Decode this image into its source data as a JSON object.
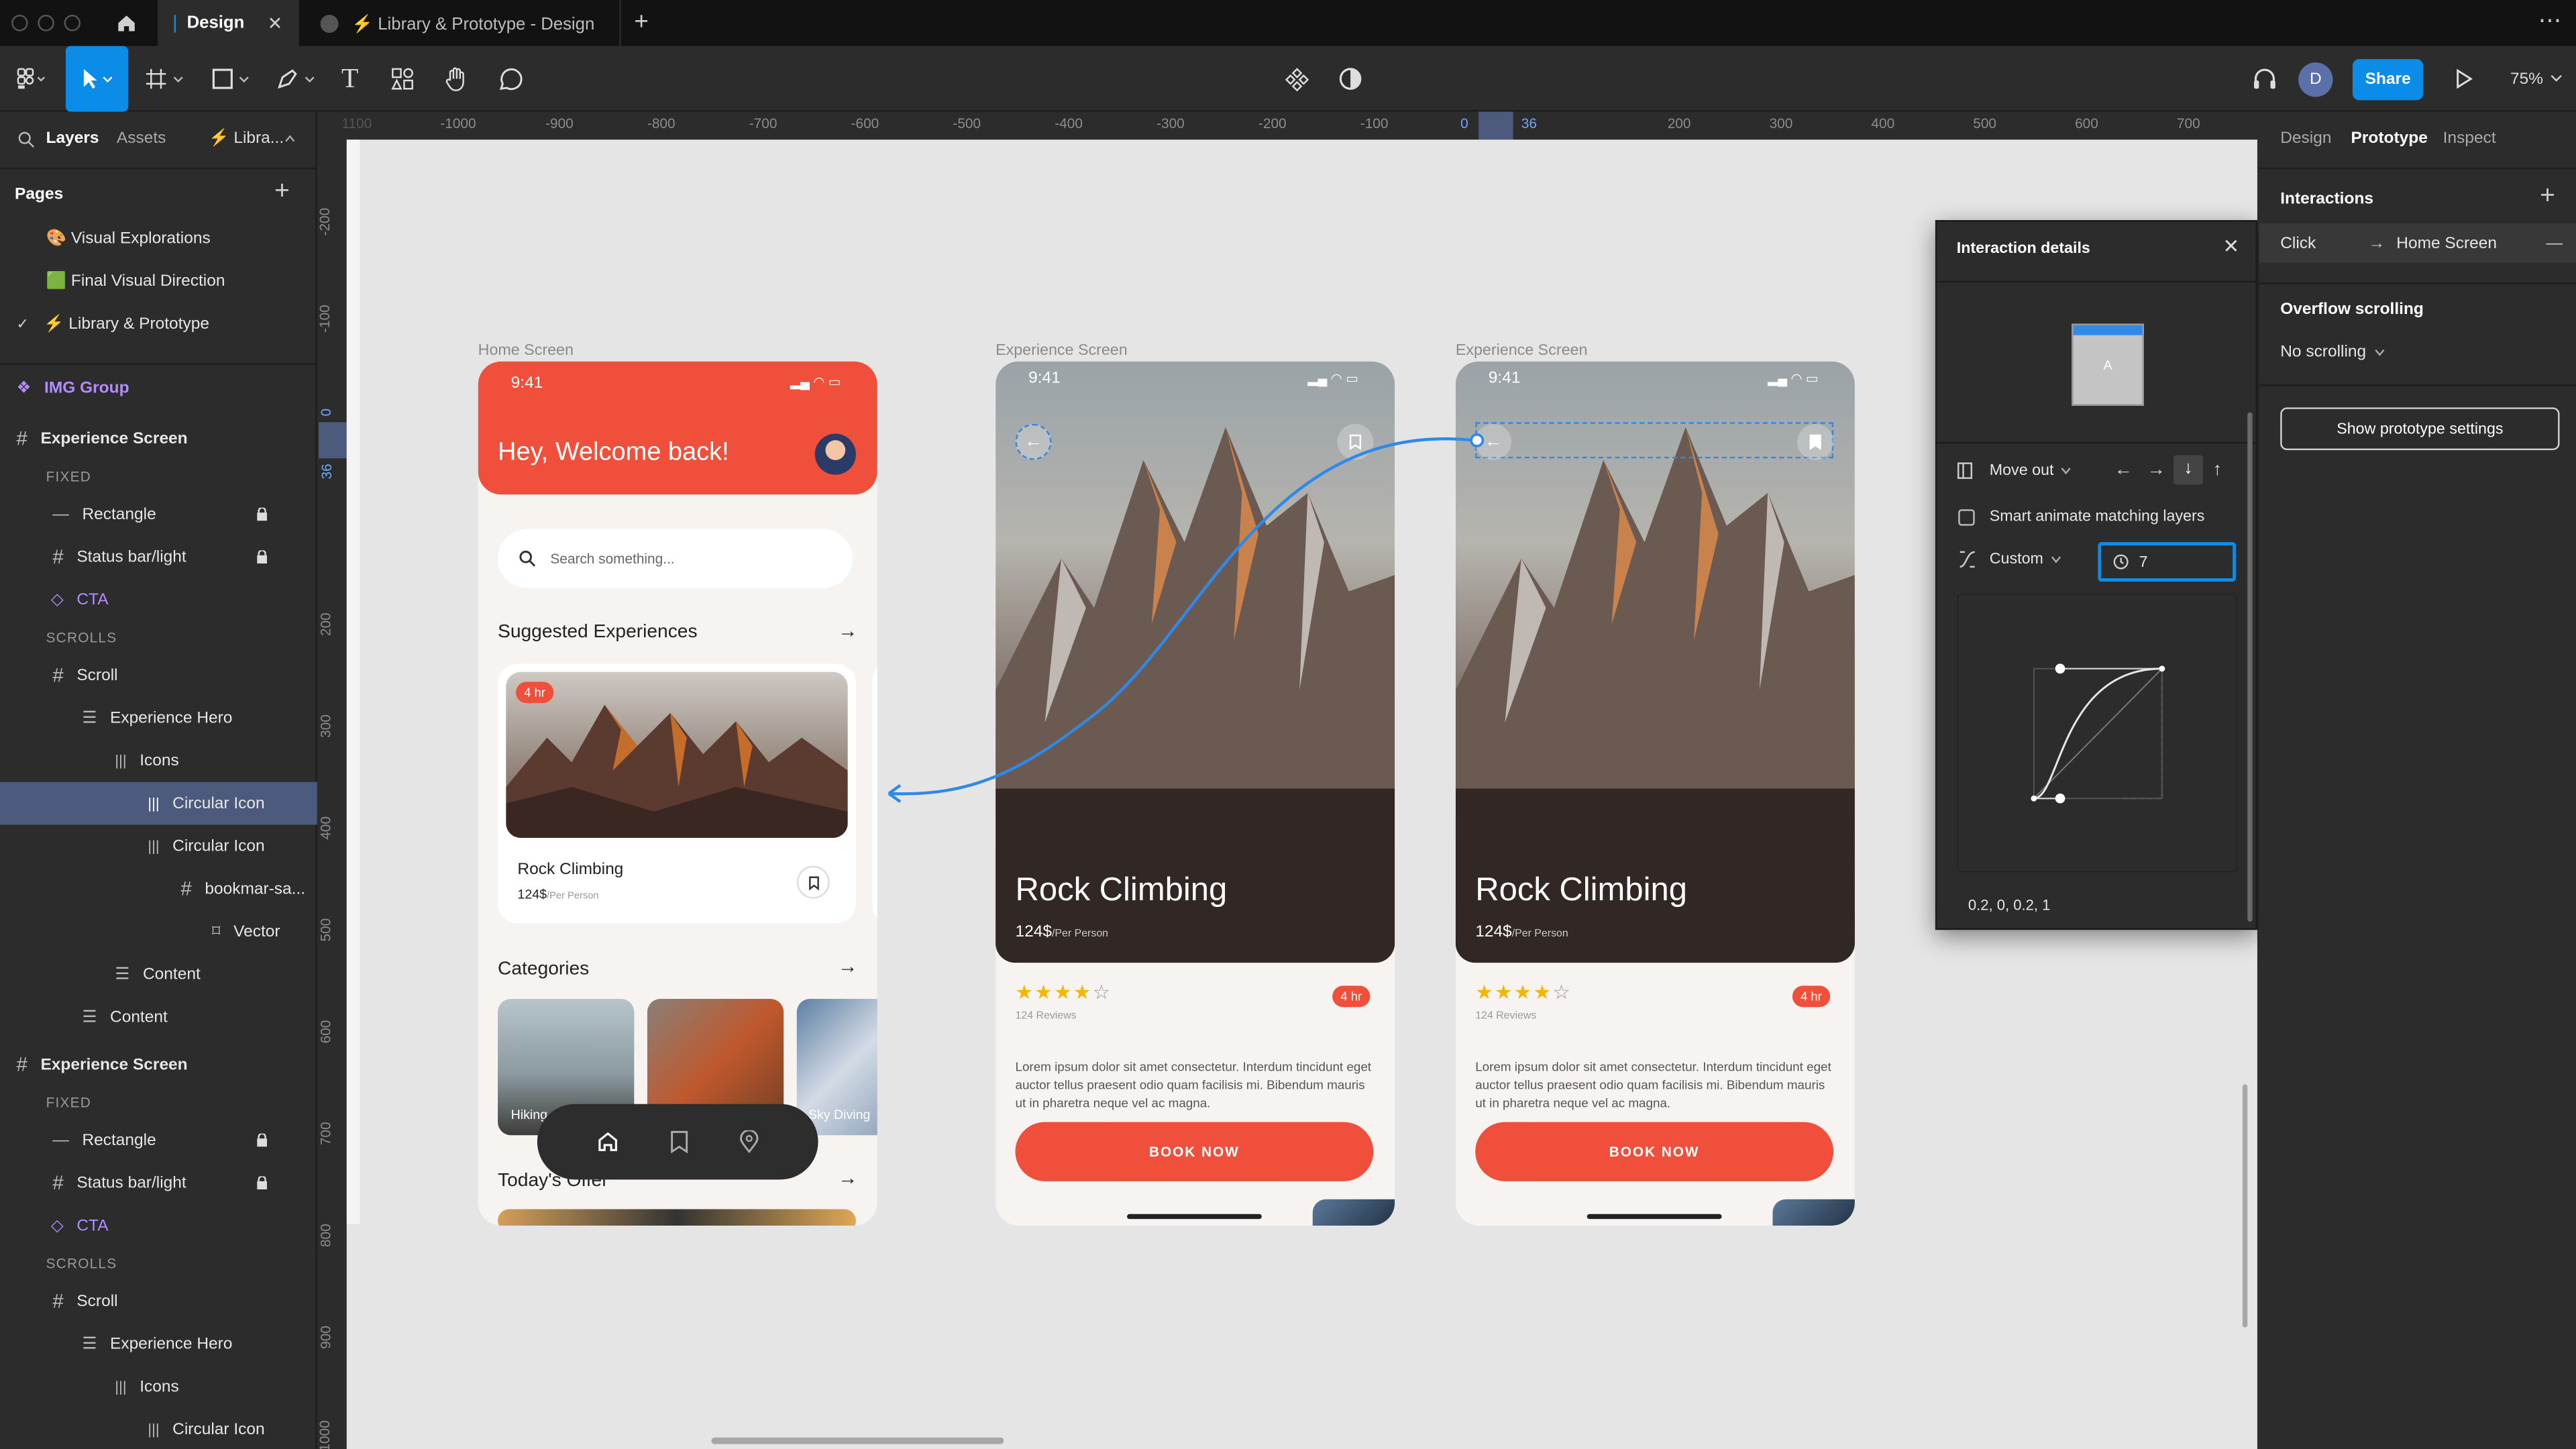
{
  "tabs": {
    "design": "Design",
    "file": "⚡ Library & Prototype - Design"
  },
  "toolbar": {
    "share": "Share",
    "avatar": "D",
    "zoom": "75%"
  },
  "left_panel": {
    "tab_layers": "Layers",
    "tab_assets": "Assets",
    "tab_library": "⚡ Libra...",
    "pages_heading": "Pages",
    "pages": [
      {
        "label": "🎨 Visual Explorations"
      },
      {
        "label": "🟩 Final Visual Direction"
      },
      {
        "label": "⚡ Library & Prototype"
      }
    ],
    "layers": [
      {
        "label": "IMG Group"
      },
      {
        "label": "Experience Screen"
      },
      {
        "label": "FIXED"
      },
      {
        "label": "Rectangle"
      },
      {
        "label": "Status bar/light"
      },
      {
        "label": "CTA"
      },
      {
        "label": "SCROLLS"
      },
      {
        "label": "Scroll"
      },
      {
        "label": "Experience Hero"
      },
      {
        "label": "Icons"
      },
      {
        "label": "Circular Icon"
      },
      {
        "label": "Circular Icon"
      },
      {
        "label": "bookmar-sa..."
      },
      {
        "label": "Vector"
      },
      {
        "label": "Content"
      },
      {
        "label": "Content"
      },
      {
        "label": "Experience Screen"
      },
      {
        "label": "FIXED"
      },
      {
        "label": "Rectangle"
      },
      {
        "label": "Status bar/light"
      },
      {
        "label": "CTA"
      },
      {
        "label": "SCROLLS"
      },
      {
        "label": "Scroll"
      },
      {
        "label": "Experience Hero"
      },
      {
        "label": "Icons"
      },
      {
        "label": "Circular Icon"
      }
    ]
  },
  "ruler_top": [
    "1100",
    "-1000",
    "-900",
    "-800",
    "-700",
    "-600",
    "-500",
    "-400",
    "-300",
    "-200",
    "-100",
    "0",
    "36",
    "200",
    "300",
    "400",
    "500",
    "600",
    "700"
  ],
  "ruler_left": [
    "-200",
    "-100",
    "0",
    "36",
    "200",
    "300",
    "400",
    "500",
    "600",
    "700",
    "800",
    "900",
    "1000"
  ],
  "canvas": {
    "home": {
      "frame_label": "Home Screen",
      "time": "9:41",
      "greeting": "Hey, Welcome back!",
      "search_placeholder": "Search something...",
      "suggested": "Suggested Experiences",
      "card_badge": "4 hr",
      "card_title": "Rock Climbing",
      "card_price": "124$",
      "card_per": "/Per Person",
      "categories": "Categories",
      "cat_hiking": "Hiking",
      "cat_sky": "Sky Diving",
      "today": "Today's Offer"
    },
    "exp1": {
      "frame_label": "Experience Screen",
      "time": "9:41",
      "title": "Rock Climbing",
      "price": "124$",
      "per": "/Per Person",
      "badge": "4 hr",
      "reviews": "124 Reviews",
      "rating": 4,
      "body": "Lorem ipsum dolor sit amet consectetur. Interdum tincidunt eget auctor tellus praesent odio quam facilisis mi. Bibendum mauris ut in pharetra neque vel ac magna.",
      "cta": "BOOK NOW"
    },
    "exp2": {
      "frame_label": "Experience Screen",
      "time": "9:41",
      "title": "Rock Climbing",
      "price": "124$",
      "per": "/Per Person",
      "badge": "4 hr",
      "reviews": "124 Reviews",
      "rating": 4,
      "body": "Lorem ipsum dolor sit amet consectetur. Interdum tincidunt eget auctor tellus praesent odio quam facilisis mi. Bibendum mauris ut in pharetra neque vel ac magna.",
      "cta": "BOOK NOW"
    }
  },
  "interaction": {
    "title": "Interaction details",
    "thumb_letter": "A",
    "animation": "Move out",
    "smart_animate": "Smart animate matching layers",
    "easing": "Custom",
    "duration": "7",
    "bezier": "0.2, 0, 0.2, 1"
  },
  "right_panel": {
    "tab_design": "Design",
    "tab_prototype": "Prototype",
    "tab_inspect": "Inspect",
    "interactions": "Interactions",
    "trigger": "Click",
    "destination": "Home Screen",
    "overflow": "Overflow scrolling",
    "overflow_value": "No scrolling",
    "settings_button": "Show prototype settings"
  },
  "colors": {
    "accent": "#0c8ce9",
    "brand": "#f04f3b",
    "selection": "#4c5a7d",
    "component": "#b48cff"
  }
}
